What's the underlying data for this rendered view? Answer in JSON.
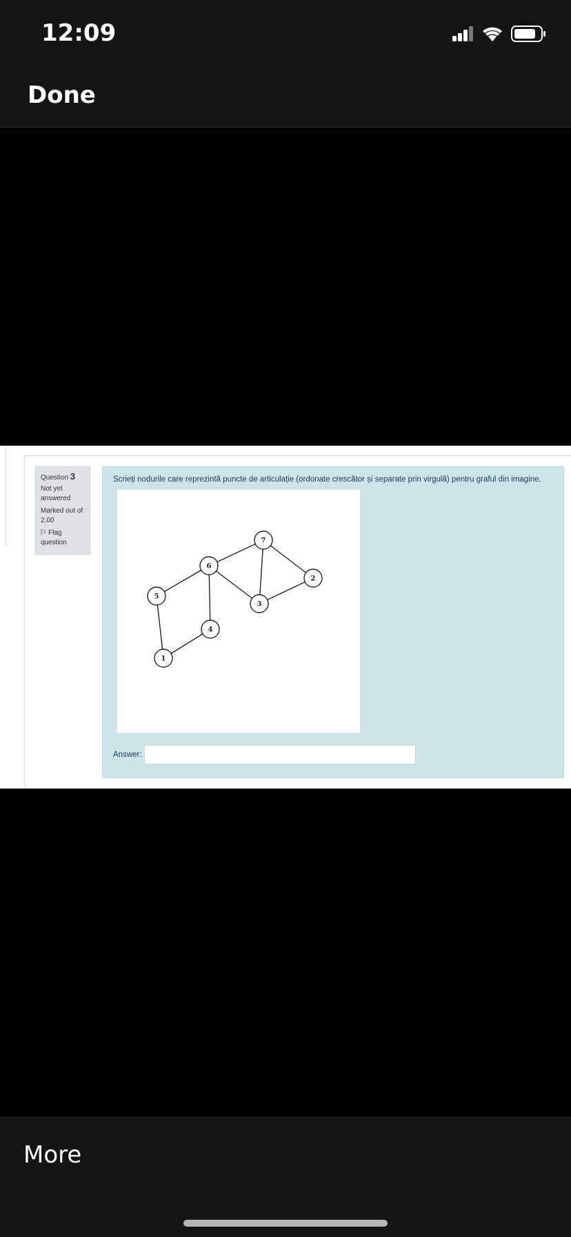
{
  "status_bar": {
    "time": "12:09"
  },
  "nav": {
    "done_label": "Done"
  },
  "question": {
    "title": "Question",
    "number": "3",
    "state": "Not yet answered",
    "marks": "Marked out of 2.00",
    "flag_label": "Flag question",
    "text": "Scrieți nodurile care reprezintă puncte de articulație (ordonate crescător și separate prin virgulă) pentru graful din imagine.",
    "answer_label": "Answer:",
    "answer_value": "",
    "answer_placeholder": ""
  },
  "graph": {
    "nodes": [
      {
        "label": "1"
      },
      {
        "label": "2"
      },
      {
        "label": "3"
      },
      {
        "label": "4"
      },
      {
        "label": "5"
      },
      {
        "label": "6"
      },
      {
        "label": "7"
      }
    ],
    "edges": [
      [
        "1",
        "5"
      ],
      [
        "1",
        "4"
      ],
      [
        "4",
        "6"
      ],
      [
        "5",
        "6"
      ],
      [
        "6",
        "7"
      ],
      [
        "6",
        "3"
      ],
      [
        "7",
        "3"
      ],
      [
        "7",
        "2"
      ],
      [
        "2",
        "3"
      ]
    ]
  },
  "bottom": {
    "more_label": "More"
  },
  "colors": {
    "bar_bg": "#141414",
    "question_bg": "#cde5ea",
    "info_bg": "#dee2e6",
    "text": "#1b3c55"
  }
}
